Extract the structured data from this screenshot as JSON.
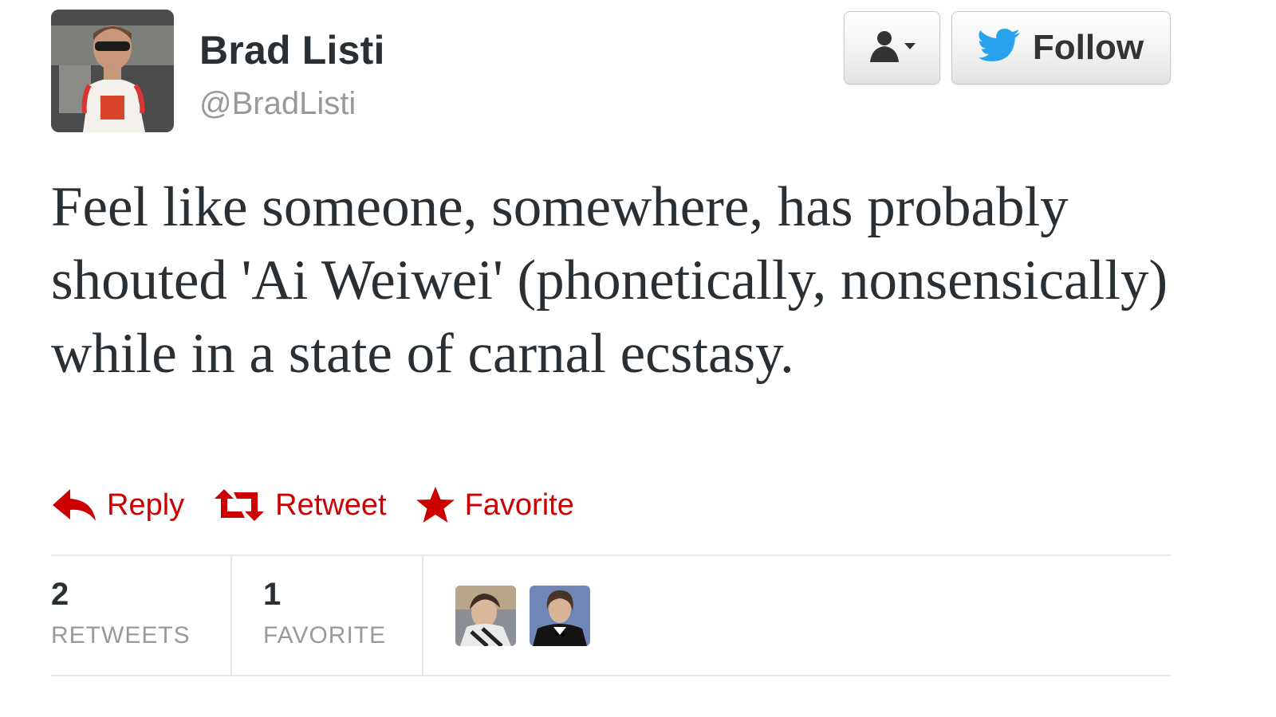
{
  "user": {
    "name": "Brad Listi",
    "handle": "@BradListi"
  },
  "buttons": {
    "user_menu_icon": "person-dropdown-icon",
    "follow_label": "Follow",
    "follow_icon": "twitter-bird-icon"
  },
  "tweet": {
    "text": "Feel like someone, somewhere, has probably shouted 'Ai Weiwei' (phonetically, nonsensically) while in a state of carnal ecstasy."
  },
  "actions": [
    {
      "label": "Reply",
      "icon": "reply-arrow-icon"
    },
    {
      "label": "Retweet",
      "icon": "retweet-icon"
    },
    {
      "label": "Favorite",
      "icon": "star-icon"
    }
  ],
  "stats": {
    "retweets": {
      "count": "2",
      "label": "RETWEETS"
    },
    "favorites": {
      "count": "1",
      "label": "FAVORITE"
    }
  },
  "colors": {
    "action": "#cc0000",
    "twitter_blue": "#2aa3ef",
    "muted": "#999999"
  }
}
